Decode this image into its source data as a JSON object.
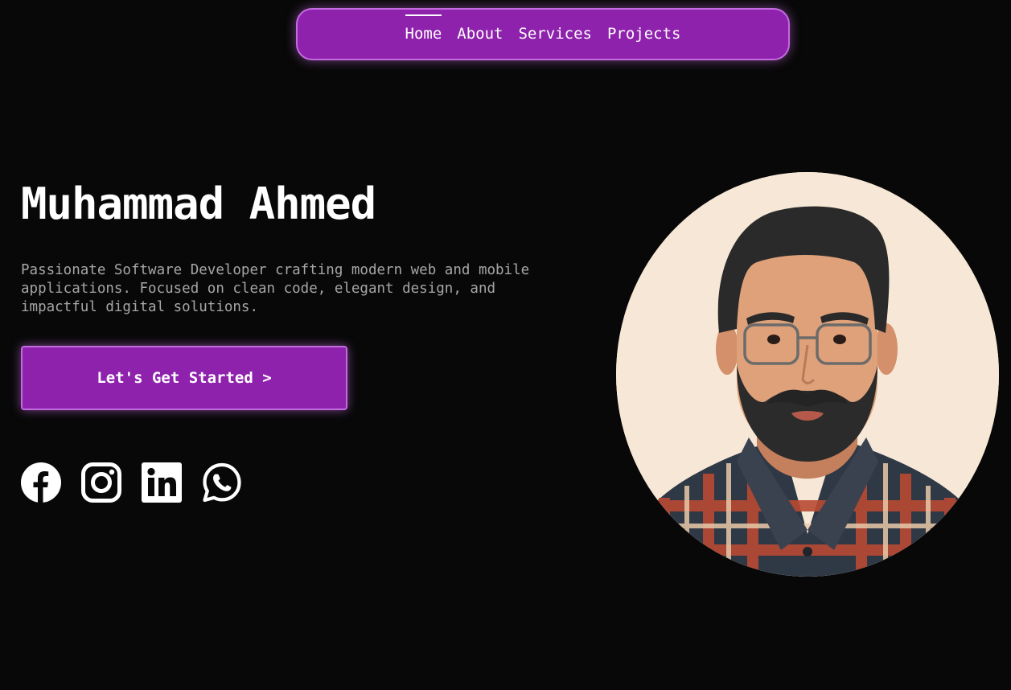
{
  "nav": {
    "items": [
      {
        "label": "Home",
        "active": true
      },
      {
        "label": "About",
        "active": false
      },
      {
        "label": "Services",
        "active": false
      },
      {
        "label": "Projects",
        "active": false
      }
    ]
  },
  "hero": {
    "name": "Muhammad Ahmed",
    "bio": "Passionate Software Developer crafting modern web and mobile applications. Focused on clean code, elegant design, and impactful digital solutions.",
    "cta_label": "Let's Get Started >"
  },
  "socials": [
    {
      "icon": "facebook-icon"
    },
    {
      "icon": "instagram-icon"
    },
    {
      "icon": "linkedin-icon"
    },
    {
      "icon": "whatsapp-icon"
    }
  ],
  "colors": {
    "background": "#080808",
    "accent": "#8e22ad",
    "accent_border": "#c46be0",
    "muted_text": "#a6a6a6",
    "avatar_bg": "#f6e7d6"
  }
}
